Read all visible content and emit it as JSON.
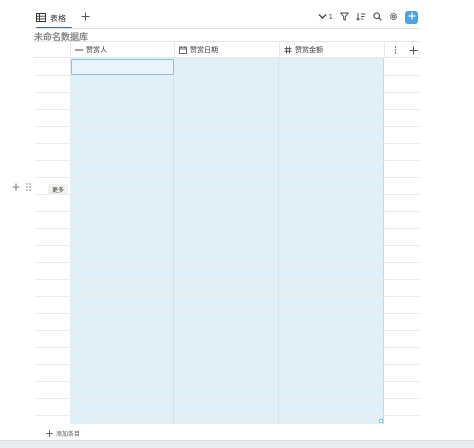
{
  "toolbar": {
    "tab_label": "表格",
    "sort_count": "1"
  },
  "database": {
    "title": "未命名数据库"
  },
  "columns": [
    {
      "label": "赞赏人",
      "icon": "text-icon"
    },
    {
      "label": "赞赏日期",
      "icon": "calendar-icon"
    },
    {
      "label": "赞赏金额",
      "icon": "number-icon"
    }
  ],
  "row_actions": {
    "more_label": "更多"
  },
  "footer": {
    "add_row_label": "添加条目"
  },
  "colors": {
    "accent": "#4aa3e6",
    "selection": "#dff0f9",
    "tab_underline": "#2f6fb5"
  }
}
